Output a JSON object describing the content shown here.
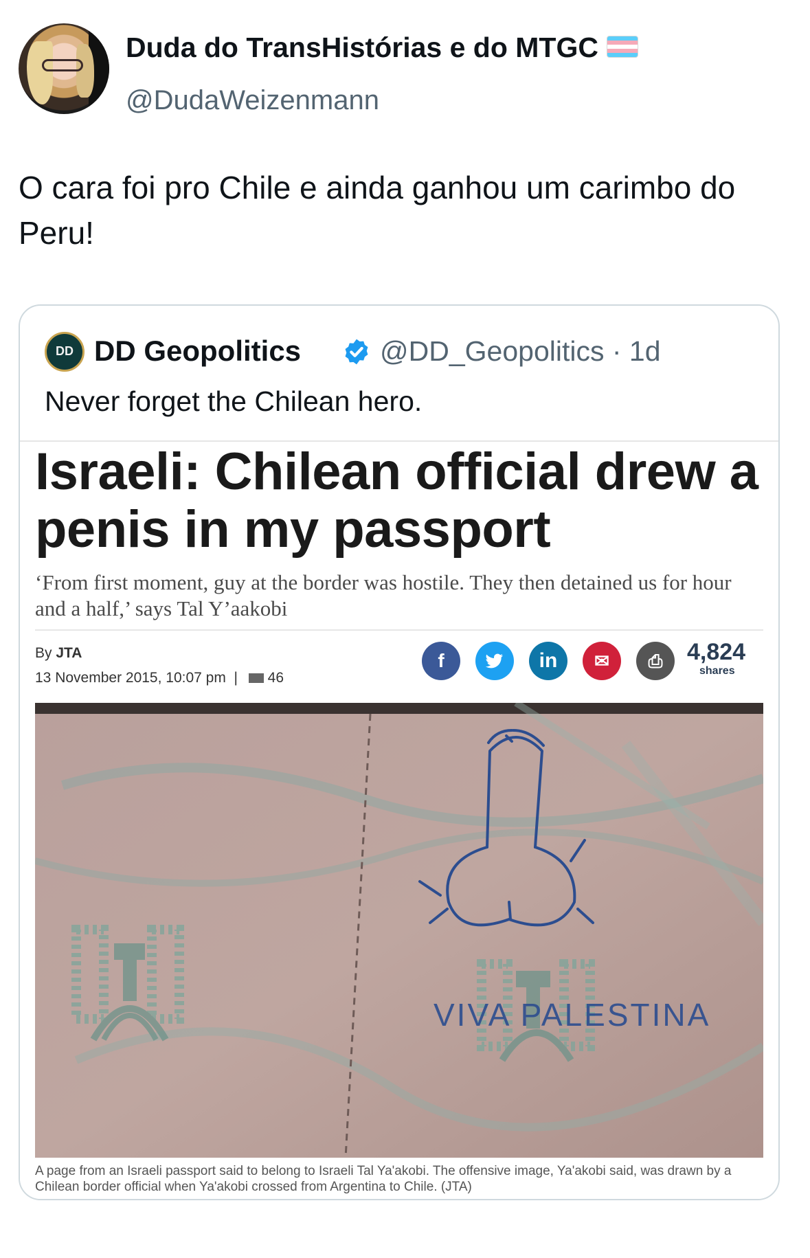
{
  "tweet": {
    "author_name": "Duda do TransHistórias e do MTGC",
    "author_handle": "@DudaWeizenmann",
    "text": "O cara foi pro Chile e ainda ganhou um carimbo do Peru!"
  },
  "quoted_tweet": {
    "logo_text": "DD",
    "author_name": "DD Geopolitics",
    "author_handle": "@DD_Geopolitics · 1d",
    "text": "Never forget the Chilean hero."
  },
  "article": {
    "headline": "Israeli: Chilean official drew a penis in my passport",
    "standfirst": "‘From first moment, guy at the border was hostile. They then detained us for hour and a half,’ says Tal Y’aakobi",
    "byline_prefix": "By",
    "byline_author": "JTA",
    "date": "13 November 2015, 10:07 pm",
    "separator": "|",
    "comment_count": "46",
    "share_icons": [
      {
        "name": "facebook-icon",
        "glyph": "f"
      },
      {
        "name": "twitter-icon",
        "glyph": "t"
      },
      {
        "name": "linkedin-icon",
        "glyph": "in"
      },
      {
        "name": "email-icon",
        "glyph": "✉"
      },
      {
        "name": "print-icon",
        "glyph": "⎙"
      }
    ],
    "share_count": "4,824",
    "share_label": "shares",
    "photo_writing": "VIVA PALESTINA",
    "caption": "A page from an Israeli passport said to belong to Israeli Tal Ya'akobi. The offensive image, Ya'akobi said, was drawn by a Chilean border official when Ya'akobi crossed from Argentina to Chile. (JTA)"
  },
  "colors": {
    "text_primary": "#0f1419",
    "text_secondary": "#536471",
    "border": "#cfd9de",
    "verified_blue": "#1d9bf0",
    "facebook": "#3b5998",
    "twitter": "#1da1f2",
    "linkedin": "#0e76a8",
    "email": "#d0213a",
    "print": "#555555"
  }
}
